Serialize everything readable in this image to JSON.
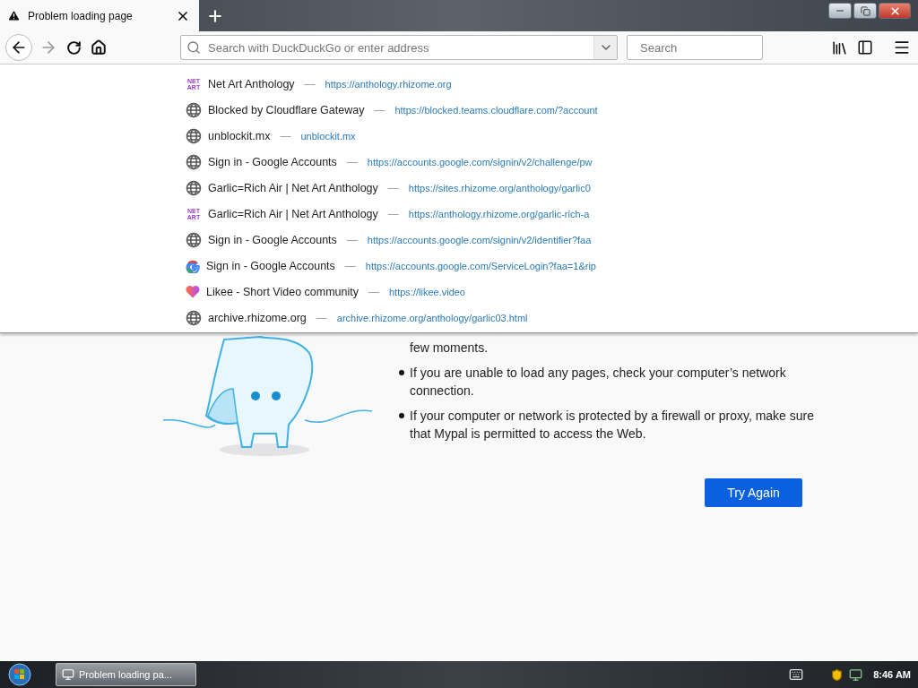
{
  "tab": {
    "title": "Problem loading page"
  },
  "toolbar": {
    "back": {
      "disabled": false
    },
    "forward": {
      "disabled": true
    },
    "address": {
      "placeholder": "Search with DuckDuckGo or enter address"
    },
    "search": {
      "placeholder": "Search"
    }
  },
  "suggestion_separator": "—",
  "suggestions": [
    {
      "kind": "netart",
      "icon_lines": [
        "NET",
        "ART"
      ],
      "title": "Net Art Anthology",
      "url": "https://anthology.rhizome.org"
    },
    {
      "kind": "globe",
      "title": "Blocked by Cloudflare Gateway",
      "url": "https://blocked.teams.cloudflare.com/?account"
    },
    {
      "kind": "globe",
      "title": "unblockit.mx",
      "url": "unblockit.mx"
    },
    {
      "kind": "globe",
      "title": "Sign in - Google Accounts",
      "url": "https://accounts.google.com/signin/v2/challenge/pw"
    },
    {
      "kind": "globe",
      "title": "Garlic=Rich Air | Net Art Anthology",
      "url": "https://sites.rhizome.org/anthology/garlic0"
    },
    {
      "kind": "netart",
      "icon_lines": [
        "NET",
        "ART"
      ],
      "title": "Garlic=Rich Air | Net Art Anthology",
      "url": "https://anthology.rhizome.org/garlic-rich-a"
    },
    {
      "kind": "globe",
      "title": "Sign in - Google Accounts",
      "url": "https://accounts.google.com/signin/v2/identifier?faa"
    },
    {
      "kind": "google",
      "title": "Sign in - Google Accounts",
      "url": "https://accounts.google.com/ServiceLogin?faa=1&rip"
    },
    {
      "kind": "likee",
      "title": "Likee - Short Video community",
      "url": "https://likee.video"
    },
    {
      "kind": "globe",
      "title": "archive.rhizome.org",
      "url": "archive.rhizome.org/anthology/garlic03.html"
    }
  ],
  "page": {
    "items": [
      {
        "text": "few moments.",
        "bullet": false
      },
      {
        "text": "If you are unable to load any pages, check your computer’s network connection.",
        "bullet": true
      },
      {
        "text": "If your computer or network is protected by a firewall or proxy, make sure that Mypal is permitted to access the Web.",
        "bullet": true
      }
    ],
    "button": "Try Again"
  },
  "taskbar": {
    "task": "Problem loading pa...",
    "clock": "8:46 AM"
  }
}
